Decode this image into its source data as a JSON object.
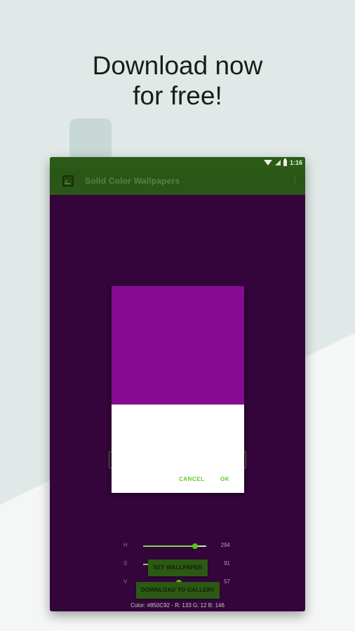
{
  "promo": {
    "headline_line1": "Download now",
    "headline_line2": "for free!"
  },
  "status_bar": {
    "time": "1:16",
    "icons": [
      "wifi-icon",
      "signal-icon",
      "battery-icon"
    ]
  },
  "app_bar": {
    "title": "Solid Color Wallpapers",
    "icon": "wallpaper-icon",
    "menu_icon": "more-vert-icon"
  },
  "dialog": {
    "preview_color": "#850C92",
    "sliders": [
      {
        "label": "H",
        "value": "294",
        "level": 0.82
      },
      {
        "label": "S",
        "value": "91",
        "level": 0.91
      },
      {
        "label": "V",
        "value": "57",
        "level": 0.57
      }
    ],
    "cancel_label": "CANCEL",
    "ok_label": "OK"
  },
  "buttons": {
    "set_wallpaper_label": "SET WALLPAPER",
    "download_label": "DOWNLOAD TO GALLERY"
  },
  "color_info": "Color: #850C92 - R: 133 G: 12 B: 146",
  "colors": {
    "background": "#E0E9E7",
    "app_bar": "#2A5716",
    "wallpaper_background": "#33053A",
    "accent": "#57C915"
  }
}
